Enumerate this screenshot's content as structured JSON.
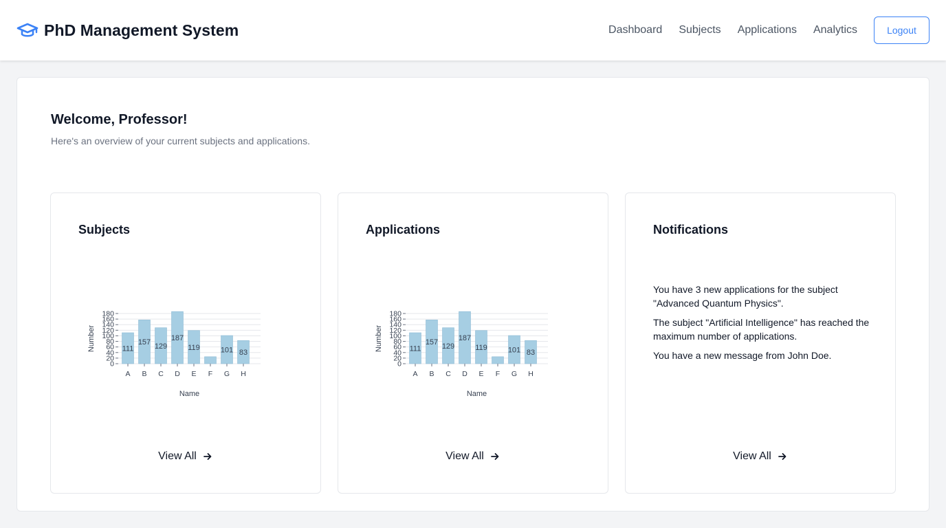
{
  "app": {
    "title": "PhD Management System"
  },
  "nav": {
    "links": [
      "Dashboard",
      "Subjects",
      "Applications",
      "Analytics"
    ],
    "logout_label": "Logout"
  },
  "welcome": {
    "title": "Welcome, Professor!",
    "subtitle": "Here's an overview of your current subjects and applications."
  },
  "cards": {
    "subjects": {
      "title": "Subjects",
      "view_all": "View All"
    },
    "applications": {
      "title": "Applications",
      "view_all": "View All"
    },
    "notifications": {
      "title": "Notifications",
      "view_all": "View All",
      "items": [
        "You have 3 new applications for the subject \"Advanced Quantum Physics\".",
        "The subject \"Artificial Intelligence\" has reached the maximum number of applications.",
        "You have a new message from John Doe."
      ]
    }
  },
  "colors": {
    "accent": "#3b82f6",
    "bar": "#a6cee3",
    "bar_stroke": "#8fbcd6"
  },
  "icons": {
    "brand": "graduation-cap-icon",
    "view_all": "arrow-right-icon"
  },
  "chart_data": [
    {
      "type": "bar",
      "categories": [
        "A",
        "B",
        "C",
        "D",
        "E",
        "F",
        "G",
        "H"
      ],
      "values": [
        111,
        157,
        129,
        187,
        119,
        25,
        101,
        83
      ],
      "data_labels": [
        "111",
        "157",
        "129",
        "187",
        "119",
        "",
        "101",
        "83"
      ],
      "xlabel": "Name",
      "ylabel": "Number",
      "yticks": [
        0,
        20,
        40,
        60,
        80,
        100,
        120,
        140,
        160,
        180
      ],
      "ylim": [
        0,
        180
      ],
      "grid": true
    },
    {
      "type": "bar",
      "categories": [
        "A",
        "B",
        "C",
        "D",
        "E",
        "F",
        "G",
        "H"
      ],
      "values": [
        111,
        157,
        129,
        187,
        119,
        25,
        101,
        83
      ],
      "data_labels": [
        "111",
        "157",
        "129",
        "187",
        "119",
        "",
        "101",
        "83"
      ],
      "xlabel": "Name",
      "ylabel": "Number",
      "yticks": [
        0,
        20,
        40,
        60,
        80,
        100,
        120,
        140,
        160,
        180
      ],
      "ylim": [
        0,
        180
      ],
      "grid": true
    }
  ]
}
